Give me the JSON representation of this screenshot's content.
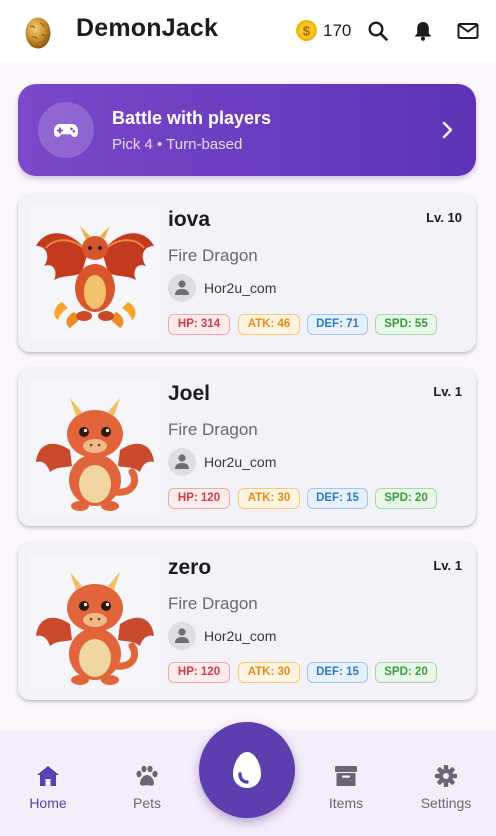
{
  "header": {
    "title": "DemonJack",
    "coins": "170",
    "icons": [
      "egg-logo",
      "coin-icon",
      "search-icon",
      "bell-icon",
      "mail-icon"
    ]
  },
  "banner": {
    "title": "Battle with players",
    "subtitle": "Pick 4 • Turn-based",
    "icon": "gamepad-icon"
  },
  "pets": [
    {
      "name": "iova",
      "level": "Lv. 10",
      "species": "Fire Dragon",
      "owner": "Hor2u_com",
      "stats": {
        "hp": "HP: 314",
        "atk": "ATK: 46",
        "def": "DEF: 71",
        "spd": "SPD: 55"
      }
    },
    {
      "name": "Joel",
      "level": "Lv. 1",
      "species": "Fire Dragon",
      "owner": "Hor2u_com",
      "stats": {
        "hp": "HP: 120",
        "atk": "ATK: 30",
        "def": "DEF: 15",
        "spd": "SPD: 20"
      }
    },
    {
      "name": "zero",
      "level": "Lv. 1",
      "species": "Fire Dragon",
      "owner": "Hor2u_com",
      "stats": {
        "hp": "HP: 120",
        "atk": "ATK: 30",
        "def": "DEF: 15",
        "spd": "SPD: 20"
      }
    }
  ],
  "nav": {
    "items": [
      {
        "label": "Home",
        "icon": "home-icon",
        "active": true
      },
      {
        "label": "Pets",
        "icon": "paw-icon",
        "active": false
      },
      {
        "label": "Items",
        "icon": "archive-box-icon",
        "active": false
      },
      {
        "label": "Settings",
        "icon": "gear-icon",
        "active": false
      }
    ],
    "fab_icon": "egg-icon"
  },
  "colors": {
    "accent": "#5c3fae",
    "banner_start": "#7b48c9",
    "banner_end": "#5d34b6",
    "hp": "#d63940",
    "atk": "#e88a12",
    "def": "#2d78c8",
    "spd": "#3a9a3e"
  }
}
